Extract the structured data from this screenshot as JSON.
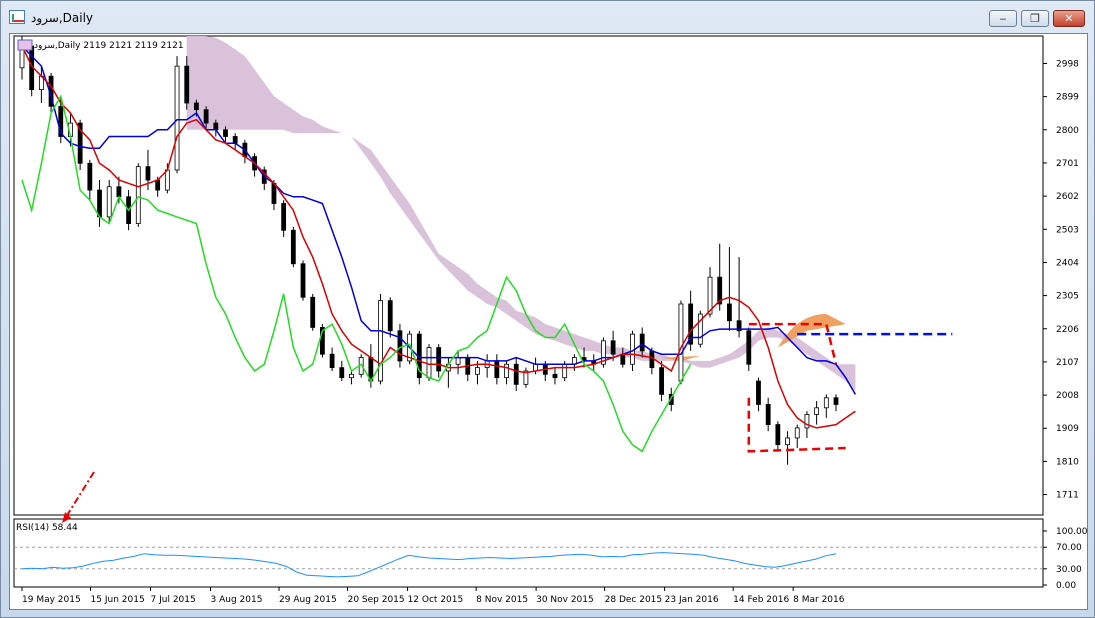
{
  "window": {
    "title": "سرود,Daily",
    "buttons": {
      "minimize": "‒",
      "maximize": "❐",
      "close": "✕"
    }
  },
  "chart_data": [
    {
      "type": "candlestick",
      "header": "سرود,Daily  2119 2121 2119 2121",
      "y_ticks": [
        "2998",
        "2899",
        "2800",
        "2701",
        "2602",
        "2503",
        "2404",
        "2305",
        "2206",
        "2107",
        "2008",
        "1909",
        "1810",
        "1711"
      ],
      "x_ticks": [
        "19 May 2015",
        "15 Jun 2015",
        "7 Jul 2015",
        "3 Aug 2015",
        "29 Aug 2015",
        "20 Sep 2015",
        "12 Oct 2015",
        "8 Nov 2015",
        "30 Nov 2015",
        "28 Dec 2015",
        "23 Jan 2016",
        "14 Feb 2016",
        "8 Mar 2016"
      ],
      "ylim": [
        1650,
        3080
      ],
      "candles": [
        [
          2985,
          3080,
          2950,
          3050
        ],
        [
          3050,
          3060,
          2900,
          2920
        ],
        [
          2920,
          2990,
          2880,
          2960
        ],
        [
          2960,
          2970,
          2850,
          2870
        ],
        [
          2870,
          2900,
          2760,
          2780
        ],
        [
          2780,
          2850,
          2750,
          2820
        ],
        [
          2820,
          2830,
          2680,
          2700
        ],
        [
          2700,
          2710,
          2590,
          2620
        ],
        [
          2620,
          2650,
          2510,
          2540
        ],
        [
          2540,
          2650,
          2520,
          2630
        ],
        [
          2630,
          2660,
          2580,
          2600
        ],
        [
          2600,
          2620,
          2500,
          2520
        ],
        [
          2520,
          2700,
          2510,
          2690
        ],
        [
          2690,
          2740,
          2620,
          2650
        ],
        [
          2650,
          2660,
          2600,
          2620
        ],
        [
          2620,
          2700,
          2610,
          2680
        ],
        [
          2680,
          3020,
          2670,
          2990
        ],
        [
          2990,
          3020,
          2860,
          2880
        ],
        [
          2880,
          2890,
          2840,
          2860
        ],
        [
          2860,
          2870,
          2800,
          2820
        ],
        [
          2820,
          2830,
          2780,
          2800
        ],
        [
          2800,
          2810,
          2760,
          2780
        ],
        [
          2780,
          2790,
          2740,
          2760
        ],
        [
          2760,
          2770,
          2700,
          2720
        ],
        [
          2720,
          2730,
          2660,
          2680
        ],
        [
          2680,
          2690,
          2620,
          2640
        ],
        [
          2640,
          2650,
          2560,
          2580
        ],
        [
          2580,
          2590,
          2480,
          2500
        ],
        [
          2500,
          2510,
          2390,
          2400
        ],
        [
          2400,
          2410,
          2290,
          2300
        ],
        [
          2300,
          2310,
          2200,
          2210
        ],
        [
          2210,
          2220,
          2120,
          2130
        ],
        [
          2130,
          2150,
          2080,
          2090
        ],
        [
          2090,
          2110,
          2050,
          2060
        ],
        [
          2060,
          2080,
          2040,
          2070
        ],
        [
          2070,
          2130,
          2060,
          2120
        ],
        [
          2120,
          2160,
          2030,
          2050
        ],
        [
          2050,
          2310,
          2040,
          2290
        ],
        [
          2290,
          2300,
          2180,
          2200
        ],
        [
          2200,
          2220,
          2090,
          2110
        ],
        [
          2110,
          2200,
          2100,
          2190
        ],
        [
          2190,
          2200,
          2040,
          2060
        ],
        [
          2060,
          2160,
          2050,
          2150
        ],
        [
          2150,
          2160,
          2060,
          2080
        ],
        [
          2080,
          2120,
          2030,
          2100
        ],
        [
          2100,
          2140,
          2070,
          2120
        ],
        [
          2120,
          2130,
          2050,
          2070
        ],
        [
          2070,
          2110,
          2040,
          2090
        ],
        [
          2090,
          2130,
          2060,
          2110
        ],
        [
          2110,
          2130,
          2040,
          2060
        ],
        [
          2060,
          2110,
          2040,
          2100
        ],
        [
          2100,
          2120,
          2020,
          2040
        ],
        [
          2040,
          2090,
          2030,
          2080
        ],
        [
          2080,
          2120,
          2070,
          2100
        ],
        [
          2100,
          2110,
          2050,
          2070
        ],
        [
          2070,
          2090,
          2040,
          2060
        ],
        [
          2060,
          2110,
          2050,
          2100
        ],
        [
          2100,
          2130,
          2080,
          2120
        ],
        [
          2120,
          2150,
          2090,
          2110
        ],
        [
          2110,
          2130,
          2080,
          2100
        ],
        [
          2100,
          2180,
          2090,
          2170
        ],
        [
          2170,
          2200,
          2110,
          2130
        ],
        [
          2130,
          2150,
          2090,
          2100
        ],
        [
          2100,
          2200,
          2080,
          2190
        ],
        [
          2190,
          2210,
          2120,
          2140
        ],
        [
          2140,
          2150,
          2070,
          2090
        ],
        [
          2090,
          2110,
          1990,
          2010
        ],
        [
          2010,
          2030,
          1960,
          1980
        ],
        [
          2050,
          2290,
          2040,
          2280
        ],
        [
          2280,
          2320,
          2140,
          2160
        ],
        [
          2160,
          2260,
          2150,
          2250
        ],
        [
          2250,
          2390,
          2240,
          2360
        ],
        [
          2360,
          2460,
          2260,
          2280
        ],
        [
          2280,
          2450,
          2200,
          2230
        ],
        [
          2230,
          2420,
          2180,
          2200
        ],
        [
          2200,
          2210,
          2080,
          2100
        ],
        [
          2050,
          2060,
          1960,
          1980
        ],
        [
          1980,
          2000,
          1900,
          1920
        ],
        [
          1920,
          1930,
          1840,
          1860
        ],
        [
          1860,
          1900,
          1800,
          1880
        ],
        [
          1880,
          1920,
          1850,
          1910
        ],
        [
          1910,
          1960,
          1880,
          1950
        ],
        [
          1950,
          1990,
          1920,
          1970
        ],
        [
          1970,
          2010,
          1940,
          2000
        ],
        [
          2000,
          2010,
          1960,
          1980
        ]
      ],
      "lines": {
        "tenkan": [
          3050,
          2990,
          2960,
          2930,
          2880,
          2850,
          2800,
          2770,
          2700,
          2680,
          2650,
          2640,
          2630,
          2640,
          2650,
          2680,
          2780,
          2820,
          2830,
          2800,
          2770,
          2760,
          2740,
          2720,
          2700,
          2670,
          2640,
          2600,
          2560,
          2480,
          2420,
          2340,
          2250,
          2200,
          2160,
          2140,
          2120,
          2100,
          2150,
          2130,
          2120,
          2110,
          2100,
          2100,
          2090,
          2090,
          2095,
          2100,
          2100,
          2095,
          2090,
          2080,
          2075,
          2080,
          2085,
          2090,
          2090,
          2090,
          2095,
          2100,
          2110,
          2120,
          2130,
          2130,
          2125,
          2120,
          2100,
          2080,
          2150,
          2200,
          2230,
          2260,
          2290,
          2300,
          2290,
          2270,
          2230,
          2150,
          2050,
          1980,
          1940,
          1920,
          1910,
          1915,
          1920,
          1940,
          1960
        ],
        "kijun": [
          3050,
          3020,
          2990,
          2900,
          2790,
          2760,
          2750,
          2745,
          2745,
          2780,
          2780,
          2780,
          2780,
          2780,
          2800,
          2800,
          2830,
          2830,
          2850,
          2800,
          2800,
          2760,
          2760,
          2740,
          2700,
          2660,
          2640,
          2610,
          2600,
          2600,
          2590,
          2580,
          2500,
          2420,
          2330,
          2230,
          2200,
          2200,
          2190,
          2180,
          2150,
          2120,
          2120,
          2120,
          2120,
          2120,
          2120,
          2120,
          2110,
          2110,
          2110,
          2120,
          2110,
          2100,
          2100,
          2100,
          2100,
          2100,
          2110,
          2110,
          2120,
          2120,
          2130,
          2140,
          2160,
          2140,
          2130,
          2130,
          2130,
          2180,
          2180,
          2200,
          2205,
          2205,
          2205,
          2205,
          2205,
          2205,
          2210,
          2180,
          2150,
          2120,
          2110,
          2110,
          2100,
          2060,
          2010
        ],
        "chikou": [
          2650,
          2560,
          2700,
          2850,
          2900,
          2780,
          2620,
          2590,
          2540,
          2520,
          2600,
          2560,
          2600,
          2590,
          2560,
          2550,
          2540,
          2530,
          2520,
          2400,
          2300,
          2250,
          2180,
          2120,
          2080,
          2100,
          2200,
          2310,
          2150,
          2080,
          2100,
          2200,
          2220,
          2160,
          2080,
          2100,
          2050,
          2100,
          2120,
          2150,
          2160,
          2080,
          2060,
          2050,
          2100,
          2140,
          2150,
          2180,
          2200,
          2280,
          2360,
          2320,
          2250,
          2200,
          2180,
          2180,
          2220,
          2160,
          2100,
          2080,
          2050,
          1980,
          1900,
          1860,
          1840,
          1900,
          1950,
          2000,
          2050,
          2100
        ]
      },
      "cloud": {
        "upper": [
          3080,
          3080,
          3080,
          3075,
          3060,
          3040,
          3020,
          2980,
          2940,
          2900,
          2880,
          2860,
          2840,
          2830,
          2810,
          2800,
          2790,
          2780,
          2760,
          2740,
          2700,
          2660,
          2620,
          2580,
          2530,
          2480,
          2430,
          2410,
          2390,
          2370,
          2340,
          2320,
          2300,
          2290,
          2260,
          2250,
          2240,
          2220,
          2210,
          2200,
          2190,
          2180,
          2170,
          2160,
          2150,
          2150,
          2140,
          2140,
          2130,
          2130,
          2120,
          2120,
          2110,
          2110,
          2110,
          2120,
          2130,
          2150,
          2170,
          2200,
          2210,
          2200,
          2190,
          2180,
          2160,
          2140,
          2120,
          2100,
          2100,
          2100
        ],
        "lower": [
          2800,
          2800,
          2800,
          2800,
          2800,
          2800,
          2800,
          2800,
          2800,
          2800,
          2800,
          2790,
          2790,
          2790,
          2790,
          2790,
          2790,
          2780,
          2740,
          2700,
          2660,
          2610,
          2570,
          2530,
          2490,
          2450,
          2410,
          2380,
          2350,
          2320,
          2300,
          2280,
          2270,
          2250,
          2230,
          2210,
          2190,
          2180,
          2170,
          2160,
          2150,
          2140,
          2140,
          2130,
          2130,
          2120,
          2120,
          2110,
          2110,
          2110,
          2110,
          2110,
          2100,
          2090,
          2090,
          2100,
          2110,
          2120,
          2140,
          2170,
          2180,
          2180,
          2170,
          2150,
          2130,
          2110,
          2090,
          2070,
          2050,
          2020
        ]
      }
    },
    {
      "type": "line",
      "title": "RSI(14) 58.44",
      "y_ticks": [
        "100.00",
        "70.00",
        "30.00",
        "0.00"
      ],
      "ylim": [
        0,
        100
      ],
      "levels": [
        70,
        30
      ],
      "values": [
        30,
        31,
        30,
        33,
        31,
        32,
        35,
        40,
        44,
        46,
        50,
        53,
        58,
        56,
        55,
        55,
        54,
        53,
        52,
        51,
        50,
        49,
        48,
        46,
        43,
        40,
        34,
        24,
        18,
        17,
        16,
        15,
        16,
        17,
        24,
        32,
        40,
        48,
        55,
        52,
        50,
        49,
        48,
        47,
        49,
        50,
        51,
        50,
        49,
        50,
        51,
        52,
        53,
        55,
        56,
        57,
        55,
        52,
        53,
        52,
        56,
        57,
        59,
        60,
        59,
        58,
        57,
        55,
        51,
        48,
        45,
        40,
        37,
        34,
        33,
        36,
        40,
        44,
        48,
        54,
        58
      ]
    }
  ]
}
